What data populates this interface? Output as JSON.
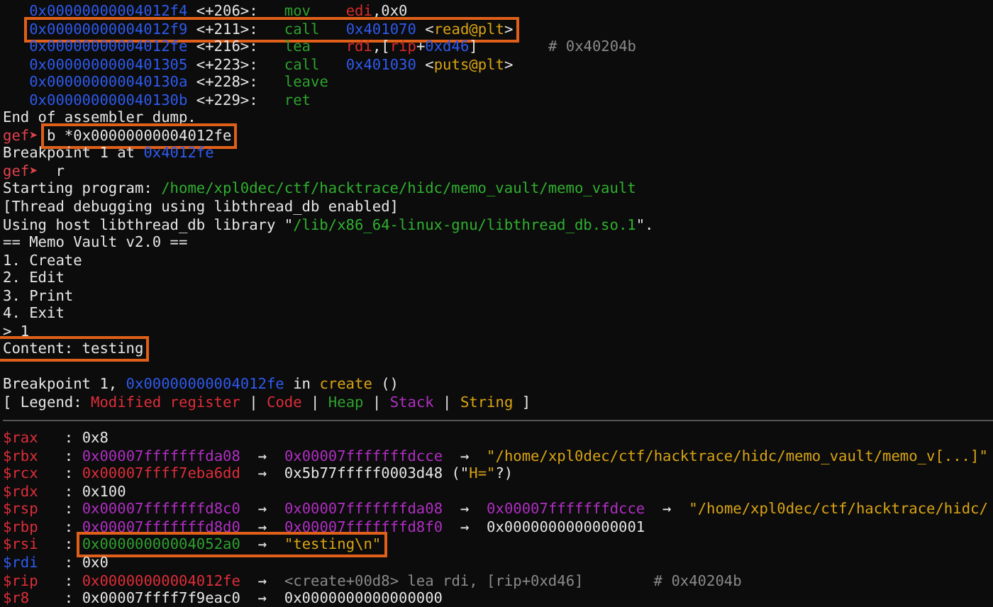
{
  "terminal": {
    "lines": [
      {
        "kind": "asm",
        "segments": [
          {
            "kind": "addr",
            "text": "0x00000000004012f4"
          },
          {
            "kind": "plain",
            "text": " <+206>:   "
          },
          {
            "kind": "op",
            "text": "mov    "
          },
          {
            "kind": "reg",
            "text": "edi"
          },
          {
            "kind": "plain",
            "text": ",0x0"
          }
        ]
      },
      {
        "kind": "asm",
        "segments": [
          {
            "kind": "box",
            "segments": [
              {
                "kind": "addr",
                "text": "0x00000000004012f9"
              },
              {
                "kind": "plain",
                "text": " <+211>:   "
              },
              {
                "kind": "op",
                "text": "call   "
              },
              {
                "kind": "addr",
                "text": "0x401070"
              },
              {
                "kind": "plain",
                "text": " <"
              },
              {
                "kind": "sym",
                "text": "read@plt"
              },
              {
                "kind": "plain",
                "text": ">"
              }
            ]
          }
        ]
      },
      {
        "kind": "asm",
        "segments": [
          {
            "kind": "addr",
            "text": "0x00000000004012fe"
          },
          {
            "kind": "plain",
            "text": " <+216>:   "
          },
          {
            "kind": "op",
            "text": "lea    "
          },
          {
            "kind": "reg",
            "text": "rdi"
          },
          {
            "kind": "plain",
            "text": ",["
          },
          {
            "kind": "reg",
            "text": "rip"
          },
          {
            "kind": "plain",
            "text": "+"
          },
          {
            "kind": "addr",
            "text": "0xd46"
          },
          {
            "kind": "plain",
            "text": "]        "
          },
          {
            "kind": "cmt",
            "text": "# 0x40204b"
          }
        ]
      },
      {
        "kind": "asm",
        "segments": [
          {
            "kind": "addr",
            "text": "0x0000000000401305"
          },
          {
            "kind": "plain",
            "text": " <+223>:   "
          },
          {
            "kind": "op",
            "text": "call   "
          },
          {
            "kind": "addr",
            "text": "0x401030"
          },
          {
            "kind": "plain",
            "text": " <"
          },
          {
            "kind": "sym",
            "text": "puts@plt"
          },
          {
            "kind": "plain",
            "text": ">"
          }
        ]
      },
      {
        "kind": "asm",
        "segments": [
          {
            "kind": "addr",
            "text": "0x000000000040130a"
          },
          {
            "kind": "plain",
            "text": " <+228>:   "
          },
          {
            "kind": "op",
            "text": "leave"
          }
        ]
      },
      {
        "kind": "asm",
        "segments": [
          {
            "kind": "addr",
            "text": "0x000000000040130b"
          },
          {
            "kind": "plain",
            "text": " <+229>:   "
          },
          {
            "kind": "op",
            "text": "ret"
          }
        ]
      },
      {
        "kind": "text",
        "segments": [
          {
            "kind": "plain",
            "text": "End of assembler dump."
          }
        ]
      },
      {
        "kind": "text",
        "segments": [
          {
            "kind": "prompt",
            "text": "gef➤ "
          },
          {
            "kind": "box",
            "segments": [
              {
                "kind": "plain",
                "text": "b *0x00000000004012fe"
              }
            ]
          }
        ]
      },
      {
        "kind": "text",
        "segments": [
          {
            "kind": "plain",
            "text": "Breakpoint 1 at "
          },
          {
            "kind": "addr",
            "text": "0x4012fe"
          }
        ]
      },
      {
        "kind": "text",
        "segments": [
          {
            "kind": "prompt",
            "text": "gef➤ "
          },
          {
            "kind": "plain",
            "text": " r"
          }
        ]
      },
      {
        "kind": "text",
        "segments": [
          {
            "kind": "plain",
            "text": "Starting program: "
          },
          {
            "kind": "path",
            "text": "/home/xpl0dec/ctf/hacktrace/hidc/memo_vault/memo_vault"
          }
        ]
      },
      {
        "kind": "text",
        "segments": [
          {
            "kind": "plain",
            "text": "[Thread debugging using libthread_db enabled]"
          }
        ]
      },
      {
        "kind": "text",
        "segments": [
          {
            "kind": "plain",
            "text": "Using host libthread_db library \""
          },
          {
            "kind": "path",
            "text": "/lib/x86_64-linux-gnu/libthread_db.so.1"
          },
          {
            "kind": "plain",
            "text": "\"."
          }
        ]
      },
      {
        "kind": "text",
        "segments": [
          {
            "kind": "plain",
            "text": "== Memo Vault v2.0 =="
          }
        ]
      },
      {
        "kind": "text",
        "segments": [
          {
            "kind": "plain",
            "text": "1. Create"
          }
        ]
      },
      {
        "kind": "text",
        "segments": [
          {
            "kind": "plain",
            "text": "2. Edit"
          }
        ]
      },
      {
        "kind": "text",
        "segments": [
          {
            "kind": "plain",
            "text": "3. Print"
          }
        ]
      },
      {
        "kind": "text",
        "segments": [
          {
            "kind": "plain",
            "text": "4. Exit"
          }
        ]
      },
      {
        "kind": "text",
        "segments": [
          {
            "kind": "plain",
            "text": "> 1"
          }
        ]
      },
      {
        "kind": "text",
        "segments": [
          {
            "kind": "box",
            "segments": [
              {
                "kind": "plain",
                "text": "Content: testing"
              }
            ]
          }
        ]
      },
      {
        "kind": "blank"
      },
      {
        "kind": "text",
        "segments": [
          {
            "kind": "plain",
            "text": "Breakpoint 1, "
          },
          {
            "kind": "addr",
            "text": "0x00000000004012fe"
          },
          {
            "kind": "plain",
            "text": " in "
          },
          {
            "kind": "sym",
            "text": "create"
          },
          {
            "kind": "plain",
            "text": " ()"
          }
        ]
      },
      {
        "kind": "text",
        "segments": [
          {
            "kind": "plain",
            "text": "[ Legend: "
          },
          {
            "kind": "code",
            "text": "Modified register"
          },
          {
            "kind": "plain",
            "text": " | "
          },
          {
            "kind": "code",
            "text": "Code"
          },
          {
            "kind": "plain",
            "text": " | "
          },
          {
            "kind": "heap",
            "text": "Heap"
          },
          {
            "kind": "plain",
            "text": " | "
          },
          {
            "kind": "stack",
            "text": "Stack"
          },
          {
            "kind": "plain",
            "text": " | "
          },
          {
            "kind": "str",
            "text": "String"
          },
          {
            "kind": "plain",
            "text": " ]"
          }
        ]
      },
      {
        "kind": "divider"
      },
      {
        "kind": "text",
        "segments": [
          {
            "kind": "regname",
            "text": "$rax"
          },
          {
            "kind": "plain",
            "text": "   : 0x8"
          }
        ]
      },
      {
        "kind": "text",
        "segments": [
          {
            "kind": "regname",
            "text": "$rbx"
          },
          {
            "kind": "plain",
            "text": "   : "
          },
          {
            "kind": "stack",
            "text": "0x00007fffffffda08"
          },
          {
            "kind": "plain",
            "text": "  →  "
          },
          {
            "kind": "stack",
            "text": "0x00007fffffffdcce"
          },
          {
            "kind": "plain",
            "text": "  →  "
          },
          {
            "kind": "str",
            "text": "\"/home/xpl0dec/ctf/hacktrace/hidc/memo_vault/memo_v[...]\""
          }
        ]
      },
      {
        "kind": "text",
        "segments": [
          {
            "kind": "regname",
            "text": "$rcx"
          },
          {
            "kind": "plain",
            "text": "   : "
          },
          {
            "kind": "code",
            "text": "0x00007ffff7eba6dd"
          },
          {
            "kind": "plain",
            "text": "  →  0x5b77fffff0003d48 (\""
          },
          {
            "kind": "str",
            "text": "H=\""
          },
          {
            "kind": "plain",
            "text": "?)"
          }
        ]
      },
      {
        "kind": "text",
        "segments": [
          {
            "kind": "regname",
            "text": "$rdx"
          },
          {
            "kind": "plain",
            "text": "   : 0x100"
          }
        ]
      },
      {
        "kind": "text",
        "segments": [
          {
            "kind": "regname",
            "text": "$rsp"
          },
          {
            "kind": "plain",
            "text": "   : "
          },
          {
            "kind": "stack",
            "text": "0x00007fffffffd8c0"
          },
          {
            "kind": "plain",
            "text": "  →  "
          },
          {
            "kind": "stack",
            "text": "0x00007fffffffda08"
          },
          {
            "kind": "plain",
            "text": "  →  "
          },
          {
            "kind": "stack",
            "text": "0x00007fffffffdcce"
          },
          {
            "kind": "plain",
            "text": "  →  "
          },
          {
            "kind": "str",
            "text": "\"/home/xpl0dec/ctf/hacktrace/hidc/"
          }
        ]
      },
      {
        "kind": "text",
        "segments": [
          {
            "kind": "regname",
            "text": "$rbp"
          },
          {
            "kind": "plain",
            "text": "   : "
          },
          {
            "kind": "stack",
            "text": "0x00007fffffffd8d0"
          },
          {
            "kind": "plain",
            "text": "  →  "
          },
          {
            "kind": "stack",
            "text": "0x00007fffffffd8f0"
          },
          {
            "kind": "plain",
            "text": "  →  0x0000000000000001"
          }
        ]
      },
      {
        "kind": "text",
        "segments": [
          {
            "kind": "regname",
            "text": "$rsi"
          },
          {
            "kind": "plain",
            "text": "   : "
          },
          {
            "kind": "box",
            "segments": [
              {
                "kind": "heap",
                "text": "0x00000000004052a0"
              },
              {
                "kind": "plain",
                "text": "  →  "
              },
              {
                "kind": "str",
                "text": "\"testing\\n\""
              }
            ]
          }
        ]
      },
      {
        "kind": "text",
        "segments": [
          {
            "kind": "regclean",
            "text": "$rdi"
          },
          {
            "kind": "plain",
            "text": "   : 0x0"
          }
        ]
      },
      {
        "kind": "text",
        "segments": [
          {
            "kind": "regname",
            "text": "$rip"
          },
          {
            "kind": "plain",
            "text": "   : "
          },
          {
            "kind": "code",
            "text": "0x00000000004012fe"
          },
          {
            "kind": "plain",
            "text": "  →  "
          },
          {
            "kind": "muted",
            "text": "<create+00d8> lea rdi, [rip+0xd46]        # 0x40204b"
          }
        ]
      },
      {
        "kind": "text",
        "segments": [
          {
            "kind": "regname",
            "text": "$r8"
          },
          {
            "kind": "plain",
            "text": "    : 0x00007ffff7f9eac0  →  0x0000000000000000"
          }
        ]
      }
    ]
  }
}
